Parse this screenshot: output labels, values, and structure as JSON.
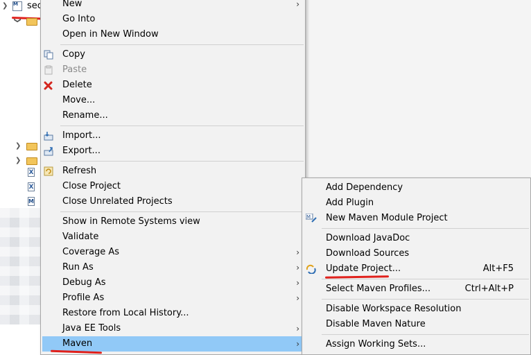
{
  "tree": {
    "project_label": "sec"
  },
  "main_menu": {
    "items": [
      {
        "label": "New",
        "submenu": true
      },
      {
        "label": "Go Into"
      },
      {
        "label": "Open in New Window"
      },
      {
        "label": "Copy",
        "icon": "copy-icon"
      },
      {
        "label": "Paste",
        "icon": "paste-icon",
        "disabled": true
      },
      {
        "label": "Delete",
        "icon": "delete-icon"
      },
      {
        "label": "Move..."
      },
      {
        "label": "Rename..."
      },
      {
        "label": "Import...",
        "icon": "import-icon"
      },
      {
        "label": "Export...",
        "icon": "export-icon"
      },
      {
        "label": "Refresh",
        "icon": "refresh-icon"
      },
      {
        "label": "Close Project"
      },
      {
        "label": "Close Unrelated Projects"
      },
      {
        "label": "Show in Remote Systems view"
      },
      {
        "label": "Validate"
      },
      {
        "label": "Coverage As",
        "submenu": true
      },
      {
        "label": "Run As",
        "submenu": true
      },
      {
        "label": "Debug As",
        "submenu": true
      },
      {
        "label": "Profile As",
        "submenu": true
      },
      {
        "label": "Restore from Local History..."
      },
      {
        "label": "Java EE Tools",
        "submenu": true
      },
      {
        "label": "Maven",
        "submenu": true,
        "selected": true
      }
    ]
  },
  "maven_menu": {
    "items": [
      {
        "label": "Add Dependency"
      },
      {
        "label": "Add Plugin"
      },
      {
        "label": "New Maven Module Project",
        "icon": "maven-module-icon"
      },
      {
        "label": "Download JavaDoc"
      },
      {
        "label": "Download Sources"
      },
      {
        "label": "Update Project...",
        "shortcut": "Alt+F5",
        "icon": "update-project-icon"
      },
      {
        "label": "Select Maven Profiles...",
        "shortcut": "Ctrl+Alt+P"
      },
      {
        "label": "Disable Workspace Resolution"
      },
      {
        "label": "Disable Maven Nature"
      },
      {
        "label": "Assign Working Sets..."
      }
    ]
  },
  "colors": {
    "menu_bg": "#f2f2f2",
    "selected_bg": "#91c9f7",
    "annotation_red": "#e0201b"
  }
}
